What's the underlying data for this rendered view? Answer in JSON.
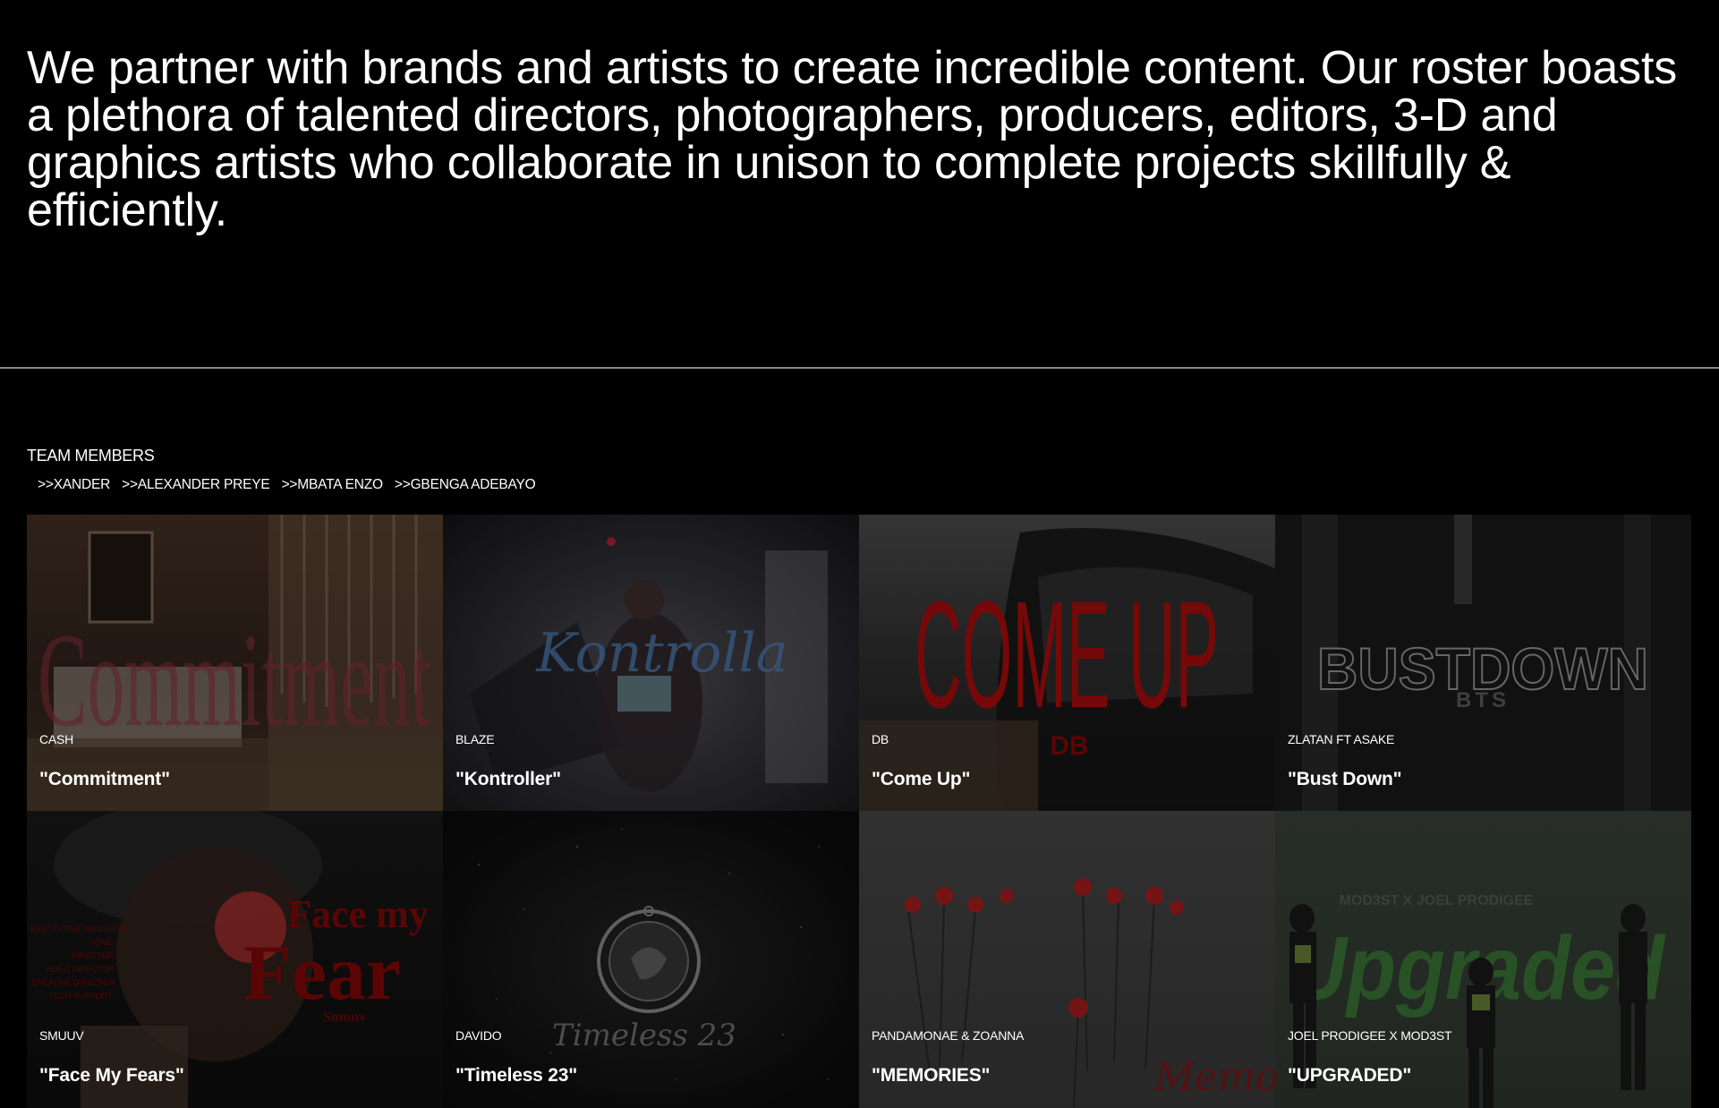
{
  "intro": {
    "text": "We partner with brands and artists to create incredible content. Our roster boasts a plethora of talented directors, photographers, producers, editors, 3-D and graphics artists who collaborate in unison to complete projects skillfully & efficiently."
  },
  "team": {
    "heading": "TEAM MEMBERS",
    "members": [
      {
        "label": ">>XANDER"
      },
      {
        "label": ">>ALEXANDER PREYE"
      },
      {
        "label": ">>MBATA ENZO"
      },
      {
        "label": ">>GBENGA ADEBAYO"
      }
    ]
  },
  "projects": [
    {
      "artist": "CASH",
      "title": "\"Commitment\"",
      "art_text": "Commitment",
      "icon": "commitment-cover",
      "color": "#4a2620"
    },
    {
      "artist": "BLAZE",
      "title": "\"Kontroller\"",
      "art_text": "Kontrolla",
      "icon": "kontroller-cover",
      "color": "#2b2a30"
    },
    {
      "artist": "DB",
      "title": "\"Come Up\"",
      "art_text": "COME UP",
      "art_sub": "DB",
      "icon": "come-up-cover",
      "color": "#8a0b0b"
    },
    {
      "artist": "ZLATAN FT ASAKE",
      "title": "\"Bust Down\"",
      "art_text": "BUSTDOWN",
      "art_sub": "BTS",
      "icon": "bust-down-cover",
      "color": "#3a3a3a"
    },
    {
      "artist": "SMUUV",
      "title": "\"Face My Fears\"",
      "art_text": "Face my",
      "art_text2": "Fear",
      "art_sub": "Smuuv",
      "icon": "face-my-fears-cover",
      "color": "#6a0606"
    },
    {
      "artist": "DAVIDO",
      "title": "\"Timeless 23\"",
      "art_text": "Timeless 23",
      "icon": "timeless-cover",
      "color": "#141414"
    },
    {
      "artist": "PANDAMONAE & ZOANNA",
      "title": "\"MEMORIES\"",
      "art_text": "Memor",
      "icon": "memories-cover",
      "color": "#8a1818"
    },
    {
      "artist": "JOEL PRODIGEE X MOD3ST",
      "title": "\"UPGRADED\"",
      "art_text": "Upgraded",
      "art_sub": "MOD3ST X JOEL PRODIGEE",
      "icon": "upgraded-cover",
      "color": "#2f6b2c"
    }
  ]
}
